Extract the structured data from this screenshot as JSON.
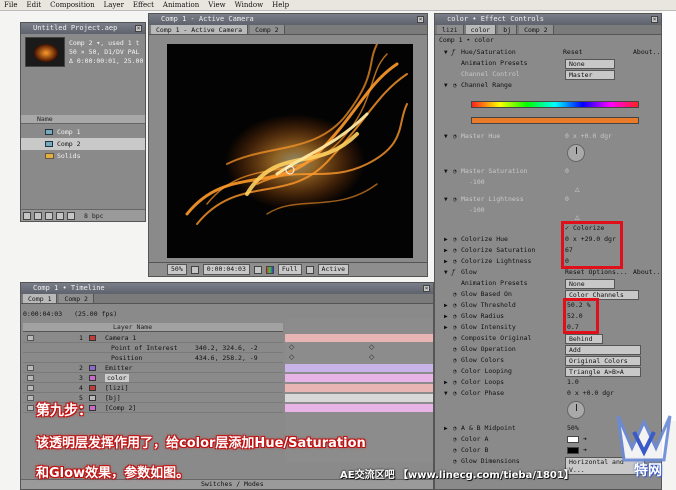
{
  "menu": [
    "File",
    "Edit",
    "Composition",
    "Layer",
    "Effect",
    "Animation",
    "View",
    "Window",
    "Help"
  ],
  "project": {
    "title": "Untitled Project.aep",
    "info_lines": [
      "Comp 2 ▾, used 1 t",
      "50 × 50, D1/DV PAL",
      "Δ 0:00:00:01, 25.00"
    ],
    "column_name": "Name",
    "items": [
      {
        "label": "Comp 1",
        "type": "comp",
        "selected": false
      },
      {
        "label": "Comp 2",
        "type": "comp",
        "selected": true
      },
      {
        "label": "Solids",
        "type": "folder",
        "selected": false
      }
    ],
    "bpc": "8 bpc"
  },
  "viewer": {
    "title": "Comp 1 - Active Camera",
    "tabs": [
      "Comp 1 - Active Camera",
      "Comp 2"
    ],
    "zoom": "50%",
    "timecode": "0:00:04:03",
    "resolution": "Full",
    "view": "Active"
  },
  "timeline": {
    "title": "Comp 1 • Timeline",
    "tabs": [
      "Comp 1",
      "Comp 2"
    ],
    "timecode": "0:00:04:03",
    "fps": "(25.00 fps)",
    "header_layer_name": "Layer Name",
    "ruler_start": "00s",
    "ruler_mark": "05s",
    "switches_label": "Switches / Modes",
    "layers": [
      {
        "num": "1",
        "name": "Camera 1",
        "color": "#c23a3a",
        "vals": "",
        "props": [
          {
            "name": "Point of Interest",
            "vals": "340.2, 324.6, -2"
          },
          {
            "name": "Position",
            "vals": "434.6, 258.2, -9"
          }
        ]
      },
      {
        "num": "2",
        "name": "Emitter",
        "color": "#8a6ac8",
        "vals": ""
      },
      {
        "num": "3",
        "name": "color",
        "color": "#c86ac8",
        "vals": ""
      },
      {
        "num": "4",
        "name": "[lizi]",
        "color": "#c23a3a",
        "vals": ""
      },
      {
        "num": "5",
        "name": "[bj]",
        "color": "#b8b8b8",
        "vals": ""
      },
      {
        "num": "6",
        "name": "[Comp 2]",
        "color": "#c86ac8",
        "vals": ""
      }
    ]
  },
  "effects": {
    "title": "color • Effect Controls",
    "tabs": [
      "lizi",
      "color",
      "bj",
      "Comp 2"
    ],
    "breadcrumb": "Comp 1 • color",
    "hue_sat": {
      "name": "Hue/Saturation",
      "reset": "Reset",
      "about": "About...",
      "animation_presets_label": "Animation Presets",
      "animation_presets_value": "None",
      "channel_control_label": "Channel Control",
      "channel_control_value": "Master",
      "channel_range_label": "Channel Range",
      "master_hue_label": "Master Hue",
      "master_hue_value": "0 x +0.0 dgr",
      "master_saturation_label": "Master Saturation",
      "master_saturation_value": "0",
      "master_saturation_min": "-100",
      "master_lightness_label": "Master Lightness",
      "master_lightness_value": "0",
      "master_lightness_min": "-100",
      "colorize_label": "Colorize",
      "colorize_hue_label": "Colorize Hue",
      "colorize_hue_value": "0 x +29.0 dgr",
      "colorize_saturation_label": "Colorize Saturation",
      "colorize_saturation_value": "67",
      "colorize_lightness_label": "Colorize Lightness",
      "colorize_lightness_value": "0"
    },
    "glow": {
      "name": "Glow",
      "reset": "Reset Options...",
      "about": "About...",
      "animation_presets_label": "Animation Presets",
      "animation_presets_value": "None",
      "based_on_label": "Glow Based On",
      "based_on_value": "Color Channels",
      "threshold_label": "Glow Threshold",
      "threshold_value": "50.2 %",
      "radius_label": "Glow Radius",
      "radius_value": "52.0",
      "intensity_label": "Glow Intensity",
      "intensity_value": "0.7",
      "composite_label": "Composite Original",
      "composite_value": "Behind",
      "operation_label": "Glow Operation",
      "operation_value": "Add",
      "colors_label": "Glow Colors",
      "colors_value": "Original Colors",
      "looping_label": "Color Looping",
      "looping_value": "Triangle A>B>A",
      "loops_label": "Color Loops",
      "loops_value": "1.0",
      "phase_label": "Color Phase",
      "phase_value": "0 x +0.0 dgr",
      "midpoint_label": "A & B Midpoint",
      "midpoint_value": "50%",
      "color_a_label": "Color A",
      "color_b_label": "Color B",
      "dimensions_label": "Glow Dimensions",
      "dimensions_value": "Horizontal and V..."
    }
  },
  "captions": {
    "step": "第九步：",
    "line1": "该透明层发挥作用了，给color层添加Hue/Saturation",
    "line2": "和Glow效果，参数如图。"
  },
  "watermark": {
    "site": "AE交流区吧 【www.linecg.com/tieba/1801】",
    "logo_text": "特网"
  },
  "colors": {
    "highlight": "#e0101a",
    "caption_outline": "#c01010",
    "glow": "#ff8a1a"
  }
}
